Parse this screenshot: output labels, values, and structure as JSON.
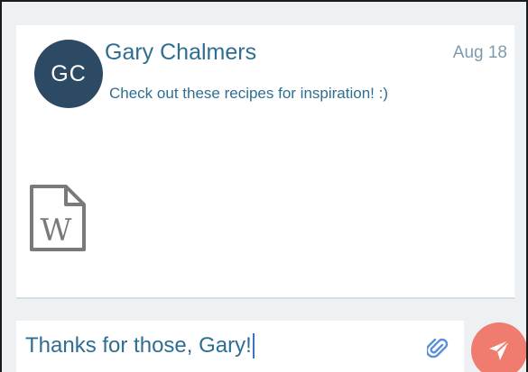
{
  "message": {
    "avatar_initials": "GC",
    "sender_name": "Gary Chalmers",
    "date": "Aug 18",
    "text": "Check out these recipes for inspiration! :)",
    "attachment_icon": "word-document-icon"
  },
  "compose": {
    "value": "Thanks for those, Gary!",
    "attach_icon": "paperclip-icon",
    "send_icon": "paper-plane-icon"
  },
  "colors": {
    "accent": "#2e6e92",
    "avatar_bg": "#2c4a63",
    "date": "#7f9aad",
    "send_button": "#f07b6f",
    "background": "#eef1f3"
  }
}
